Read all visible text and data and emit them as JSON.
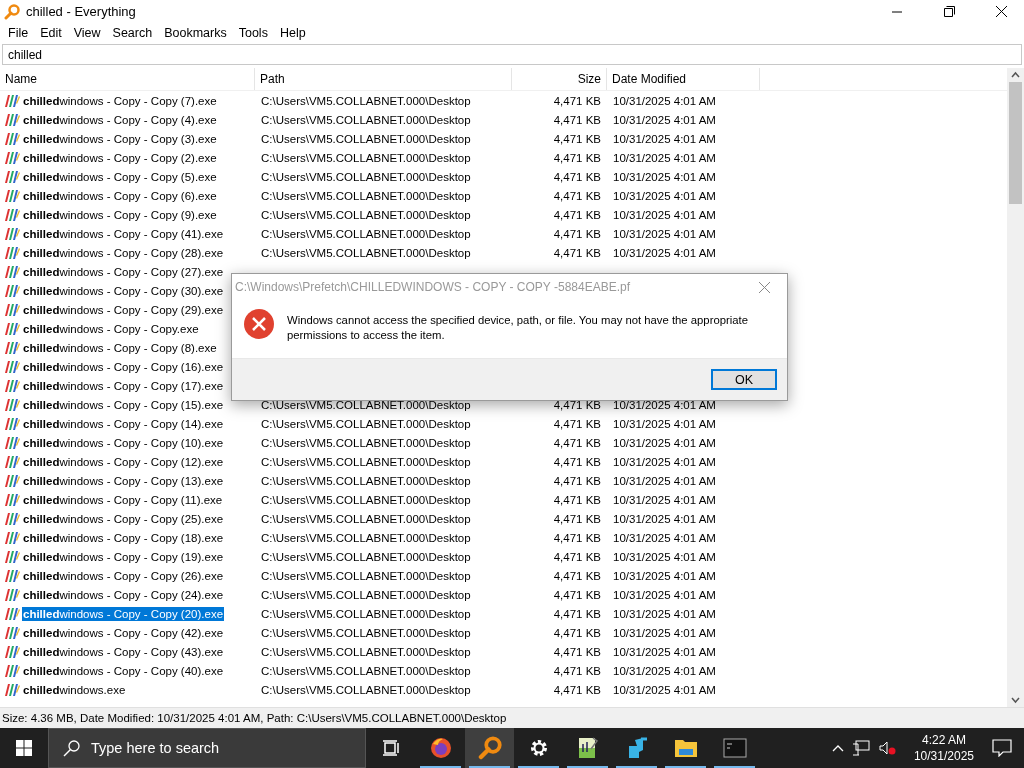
{
  "window": {
    "title": "chilled - Everything"
  },
  "menu": [
    "File",
    "Edit",
    "View",
    "Search",
    "Bookmarks",
    "Tools",
    "Help"
  ],
  "search": {
    "value": "chilled"
  },
  "table": {
    "columns": [
      "Name",
      "Path",
      "Size",
      "Date Modified"
    ],
    "rows": [
      {
        "name": "**chilled**windows - Copy - Copy (7).exe",
        "path": "C:\\Users\\VM5.COLLABNET.000\\Desktop",
        "size": "4,471 KB",
        "date": "10/31/2025 4:01 AM",
        "selected": false
      },
      {
        "name": "**chilled**windows - Copy - Copy (4).exe",
        "path": "C:\\Users\\VM5.COLLABNET.000\\Desktop",
        "size": "4,471 KB",
        "date": "10/31/2025 4:01 AM",
        "selected": false
      },
      {
        "name": "**chilled**windows - Copy - Copy (3).exe",
        "path": "C:\\Users\\VM5.COLLABNET.000\\Desktop",
        "size": "4,471 KB",
        "date": "10/31/2025 4:01 AM",
        "selected": false
      },
      {
        "name": "**chilled**windows - Copy - Copy (2).exe",
        "path": "C:\\Users\\VM5.COLLABNET.000\\Desktop",
        "size": "4,471 KB",
        "date": "10/31/2025 4:01 AM",
        "selected": false
      },
      {
        "name": "**chilled**windows - Copy - Copy (5).exe",
        "path": "C:\\Users\\VM5.COLLABNET.000\\Desktop",
        "size": "4,471 KB",
        "date": "10/31/2025 4:01 AM",
        "selected": false
      },
      {
        "name": "**chilled**windows - Copy - Copy (6).exe",
        "path": "C:\\Users\\VM5.COLLABNET.000\\Desktop",
        "size": "4,471 KB",
        "date": "10/31/2025 4:01 AM",
        "selected": false
      },
      {
        "name": "**chilled**windows - Copy - Copy (9).exe",
        "path": "C:\\Users\\VM5.COLLABNET.000\\Desktop",
        "size": "4,471 KB",
        "date": "10/31/2025 4:01 AM",
        "selected": false
      },
      {
        "name": "**chilled**windows - Copy - Copy (41).exe",
        "path": "C:\\Users\\VM5.COLLABNET.000\\Desktop",
        "size": "4,471 KB",
        "date": "10/31/2025 4:01 AM",
        "selected": false
      },
      {
        "name": "**chilled**windows - Copy - Copy (28).exe",
        "path": "C:\\Users\\VM5.COLLABNET.000\\Desktop",
        "size": "4,471 KB",
        "date": "10/31/2025 4:01 AM",
        "selected": false
      },
      {
        "name": "**chilled**windows - Copy - Copy (27).exe",
        "selected": false
      },
      {
        "name": "**chilled**windows - Copy - Copy (30).exe",
        "selected": false
      },
      {
        "name": "**chilled**windows - Copy - Copy (29).exe",
        "selected": false
      },
      {
        "name": "**chilled**windows - Copy - Copy.exe",
        "selected": false
      },
      {
        "name": "**chilled**windows - Copy - Copy (8).exe",
        "selected": false
      },
      {
        "name": "**chilled**windows - Copy - Copy (16).exe",
        "selected": false
      },
      {
        "name": "**chilled**windows - Copy - Copy (17).exe",
        "selected": false
      },
      {
        "name": "**chilled**windows - Copy - Copy (15).exe",
        "path": "C:\\Users\\VM5.COLLABNET.000\\Desktop",
        "size": "4,471 KB",
        "date": "10/31/2025 4:01 AM",
        "selected": false
      },
      {
        "name": "**chilled**windows - Copy - Copy (14).exe",
        "path": "C:\\Users\\VM5.COLLABNET.000\\Desktop",
        "size": "4,471 KB",
        "date": "10/31/2025 4:01 AM",
        "selected": false
      },
      {
        "name": "**chilled**windows - Copy - Copy (10).exe",
        "path": "C:\\Users\\VM5.COLLABNET.000\\Desktop",
        "size": "4,471 KB",
        "date": "10/31/2025 4:01 AM",
        "selected": false
      },
      {
        "name": "**chilled**windows - Copy - Copy (12).exe",
        "path": "C:\\Users\\VM5.COLLABNET.000\\Desktop",
        "size": "4,471 KB",
        "date": "10/31/2025 4:01 AM",
        "selected": false
      },
      {
        "name": "**chilled**windows - Copy - Copy (13).exe",
        "path": "C:\\Users\\VM5.COLLABNET.000\\Desktop",
        "size": "4,471 KB",
        "date": "10/31/2025 4:01 AM",
        "selected": false
      },
      {
        "name": "**chilled**windows - Copy - Copy (11).exe",
        "path": "C:\\Users\\VM5.COLLABNET.000\\Desktop",
        "size": "4,471 KB",
        "date": "10/31/2025 4:01 AM",
        "selected": false
      },
      {
        "name": "**chilled**windows - Copy - Copy (25).exe",
        "path": "C:\\Users\\VM5.COLLABNET.000\\Desktop",
        "size": "4,471 KB",
        "date": "10/31/2025 4:01 AM",
        "selected": false
      },
      {
        "name": "**chilled**windows - Copy - Copy (18).exe",
        "path": "C:\\Users\\VM5.COLLABNET.000\\Desktop",
        "size": "4,471 KB",
        "date": "10/31/2025 4:01 AM",
        "selected": false
      },
      {
        "name": "**chilled**windows - Copy - Copy (19).exe",
        "path": "C:\\Users\\VM5.COLLABNET.000\\Desktop",
        "size": "4,471 KB",
        "date": "10/31/2025 4:01 AM",
        "selected": false
      },
      {
        "name": "**chilled**windows - Copy - Copy (26).exe",
        "path": "C:\\Users\\VM5.COLLABNET.000\\Desktop",
        "size": "4,471 KB",
        "date": "10/31/2025 4:01 AM",
        "selected": false
      },
      {
        "name": "**chilled**windows - Copy - Copy (24).exe",
        "path": "C:\\Users\\VM5.COLLABNET.000\\Desktop",
        "size": "4,471 KB",
        "date": "10/31/2025 4:01 AM",
        "selected": false
      },
      {
        "name": "**chilled**windows - Copy - Copy (20).exe",
        "path": "C:\\Users\\VM5.COLLABNET.000\\Desktop",
        "size": "4,471 KB",
        "date": "10/31/2025 4:01 AM",
        "selected": true
      },
      {
        "name": "**chilled**windows - Copy - Copy (42).exe",
        "path": "C:\\Users\\VM5.COLLABNET.000\\Desktop",
        "size": "4,471 KB",
        "date": "10/31/2025 4:01 AM",
        "selected": false
      },
      {
        "name": "**chilled**windows - Copy - Copy (43).exe",
        "path": "C:\\Users\\VM5.COLLABNET.000\\Desktop",
        "size": "4,471 KB",
        "date": "10/31/2025 4:01 AM",
        "selected": false
      },
      {
        "name": "**chilled**windows - Copy - Copy (40).exe",
        "path": "C:\\Users\\VM5.COLLABNET.000\\Desktop",
        "size": "4,471 KB",
        "date": "10/31/2025 4:01 AM",
        "selected": false
      },
      {
        "name": "**chilled**windows.exe",
        "path": "C:\\Users\\VM5.COLLABNET.000\\Desktop",
        "size": "4,471 KB",
        "date": "10/31/2025 4:01 AM",
        "selected": false
      }
    ]
  },
  "status_bar": "Size: 4.36 MB, Date Modified: 10/31/2025 4:01 AM, Path: C:\\Users\\VM5.COLLABNET.000\\Desktop",
  "dialog": {
    "title": "C:\\Windows\\Prefetch\\CHILLEDWINDOWS - COPY - COPY -5884EABE.pf",
    "message": "Windows cannot access the specified device, path, or file. You may not have the appropriate permissions to access the item.",
    "button": "OK"
  },
  "taskbar": {
    "search_placeholder": "Type here to search",
    "apps": [
      {
        "kind": "taskview",
        "selected": false
      },
      {
        "kind": "firefox",
        "selected": false
      },
      {
        "kind": "everything",
        "selected": true
      },
      {
        "kind": "settings",
        "selected": false
      },
      {
        "kind": "notepad",
        "selected": false
      },
      {
        "kind": "blueapp",
        "selected": false
      },
      {
        "kind": "explorer",
        "selected": false
      },
      {
        "kind": "cmd",
        "selected": false
      }
    ],
    "time": "4:22 AM",
    "date": "10/31/2025"
  }
}
